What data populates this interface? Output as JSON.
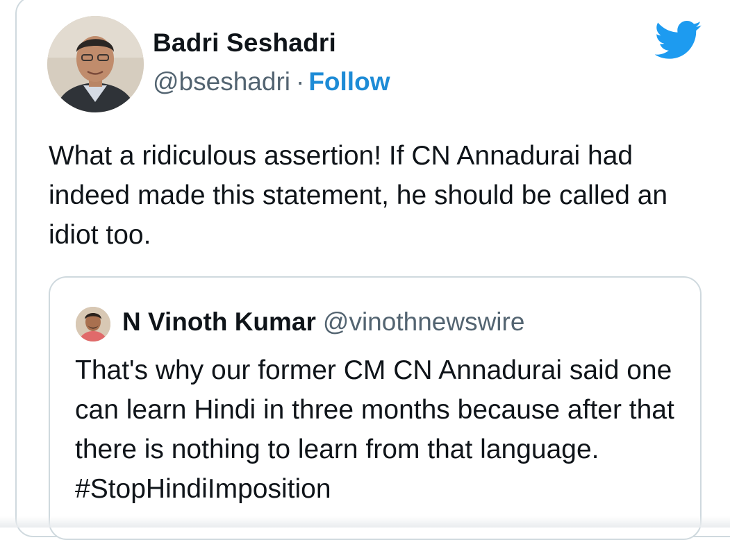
{
  "tweet": {
    "author": {
      "name": "Badri Seshadri",
      "handle": "@bseshadri",
      "separator": "·",
      "follow_label": "Follow",
      "avatar": "profile-photo"
    },
    "logo": "twitter-bird-icon",
    "text": "What a ridiculous assertion! If CN Annadurai had indeed made this statement, he should be called an idiot too."
  },
  "quoted_tweet": {
    "author": {
      "name": "N Vinoth Kumar",
      "handle": "@vinothnewswire",
      "avatar": "profile-photo"
    },
    "text": "That's why our former CM CN Annadurai said one can learn Hindi in three months because after that there is nothing to learn from that language. #StopHindiImposition"
  },
  "colors": {
    "accent": "#1d8bd6",
    "twitter_blue": "#1d9bf0",
    "text_primary": "#0f1419",
    "text_secondary": "#536471",
    "border": "#cfd9de"
  }
}
